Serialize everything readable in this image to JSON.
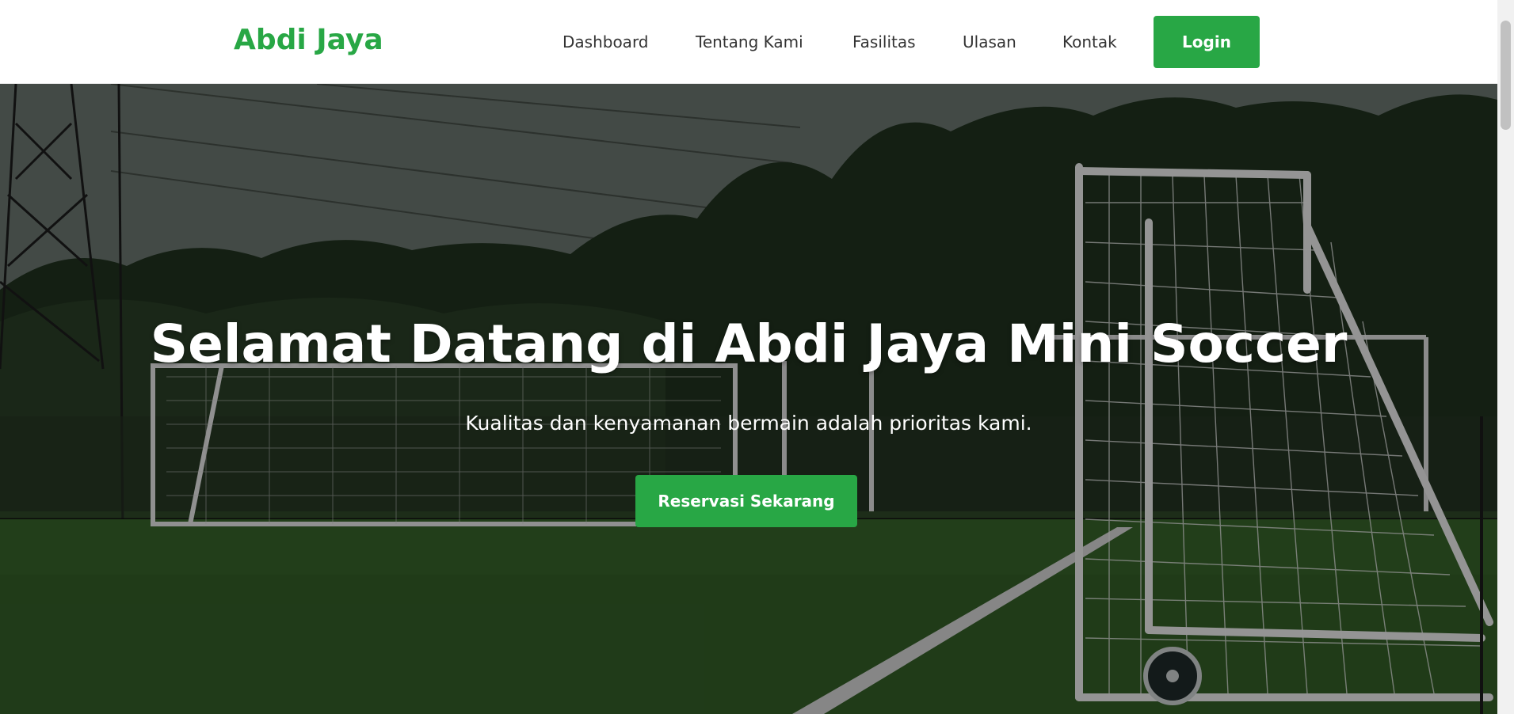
{
  "brand": {
    "name": "Abdi Jaya"
  },
  "nav": {
    "items": [
      {
        "label": "Dashboard"
      },
      {
        "label": "Tentang Kami"
      },
      {
        "label": "Fasilitas"
      },
      {
        "label": "Ulasan"
      },
      {
        "label": "Kontak"
      }
    ],
    "login_label": "Login"
  },
  "hero": {
    "title": "Selamat Datang di Abdi Jaya Mini Soccer",
    "subtitle": "Kualitas dan kenyamanan bermain adalah prioritas kami.",
    "cta_label": "Reservasi Sekarang",
    "background_image": "soccer-field-with-goals"
  },
  "colors": {
    "accent": "#28a745",
    "nav_text": "#333333",
    "hero_text": "#ffffff"
  }
}
